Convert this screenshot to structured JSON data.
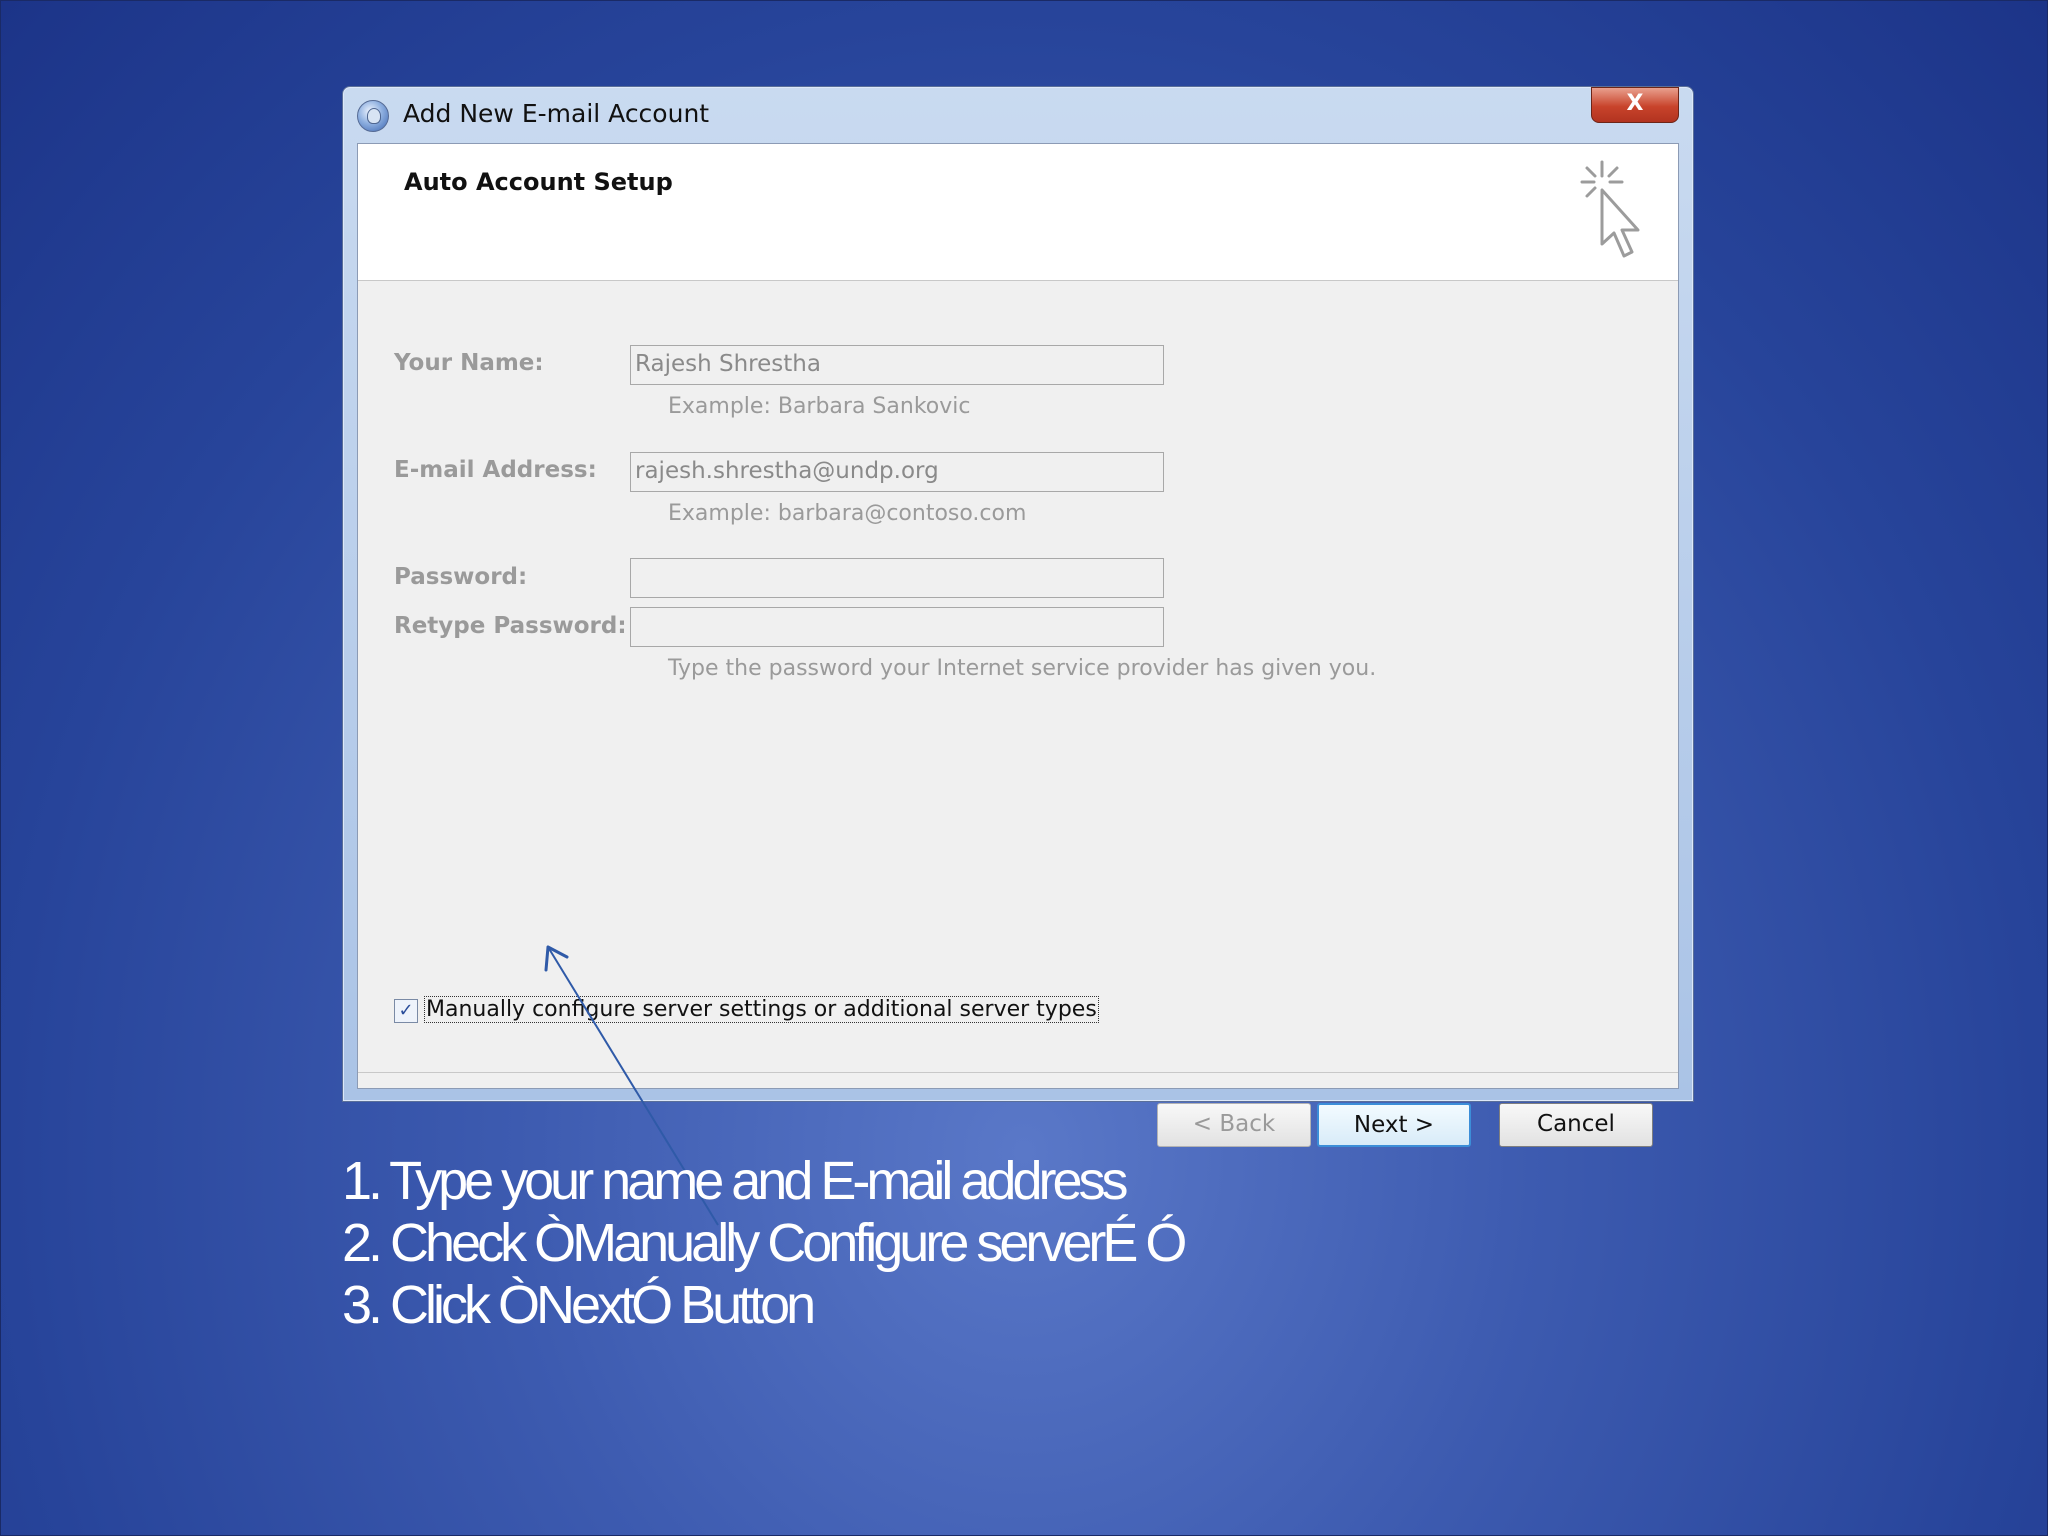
{
  "window": {
    "title": "Add New E-mail Account",
    "close_label": "X"
  },
  "header": {
    "title": "Auto Account Setup"
  },
  "form": {
    "name_label": "Your Name:",
    "name_value": "Rajesh Shrestha",
    "name_hint": "Example: Barbara Sankovic",
    "email_label": "E-mail Address:",
    "email_value": "rajesh.shrestha@undp.org",
    "email_hint": "Example: barbara@contoso.com",
    "password_label": "Password:",
    "retype_label": "Retype Password:",
    "password_hint": "Type the password your Internet service provider has given you."
  },
  "checkbox": {
    "label": "Manually configure server settings or additional server types",
    "checked": true
  },
  "buttons": {
    "back": "< Back",
    "next": "Next >",
    "cancel": "Cancel"
  },
  "instructions": [
    "1. Type your name and E-mail address",
    "2. Check ÒManually Configure serverÉ Ó",
    "3. Click ÒNextÓ Button"
  ],
  "colors": {
    "background": "#2c4aa0",
    "primary_button_border": "#3c8ed8",
    "close_button": "#c8432b"
  },
  "icons": [
    "email-account-icon",
    "wizard-sparkle-cursor-icon",
    "checkmark-icon",
    "arrow-pointer-icon"
  ]
}
